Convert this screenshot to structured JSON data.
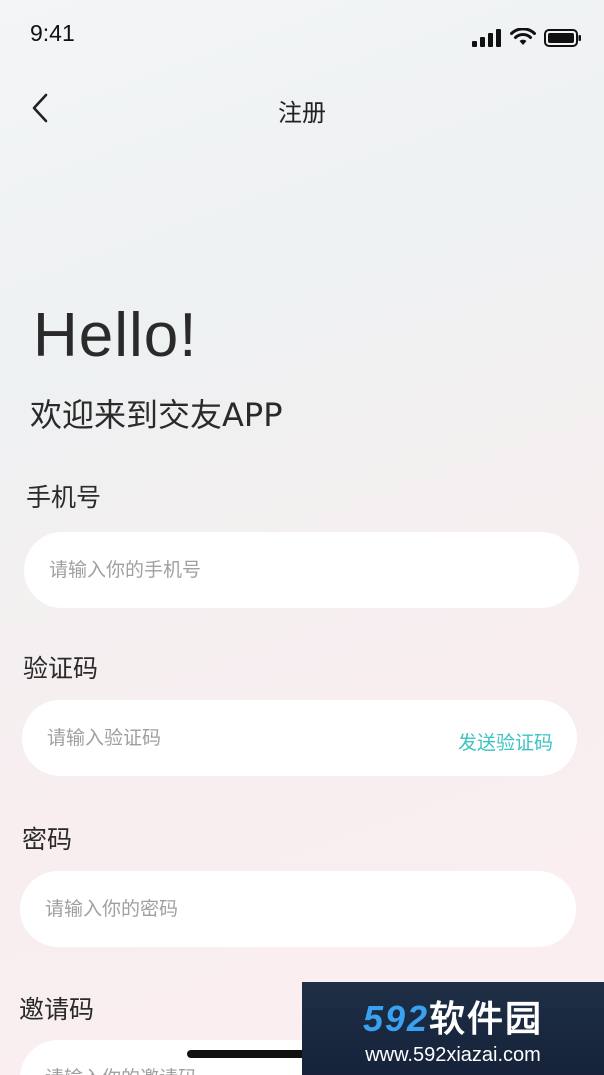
{
  "status_bar": {
    "time": "9:41"
  },
  "nav": {
    "title": "注册"
  },
  "hero": {
    "hello": "Hello!",
    "welcome": "欢迎来到交友APP"
  },
  "form": {
    "phone": {
      "label": "手机号",
      "placeholder": "请输入你的手机号"
    },
    "code": {
      "label": "验证码",
      "placeholder": "请输入验证码",
      "send_label": "发送验证码"
    },
    "password": {
      "label": "密码",
      "placeholder": "请输入你的密码"
    },
    "invite": {
      "label": "邀请码",
      "placeholder": "请输入你的邀请码"
    }
  },
  "watermark": {
    "logo_num": "592",
    "logo_text": "软件园",
    "url": "www.592xiazai.com"
  },
  "colors": {
    "accent": "#3cc4c0",
    "watermark_blue": "#3aa0f0"
  }
}
